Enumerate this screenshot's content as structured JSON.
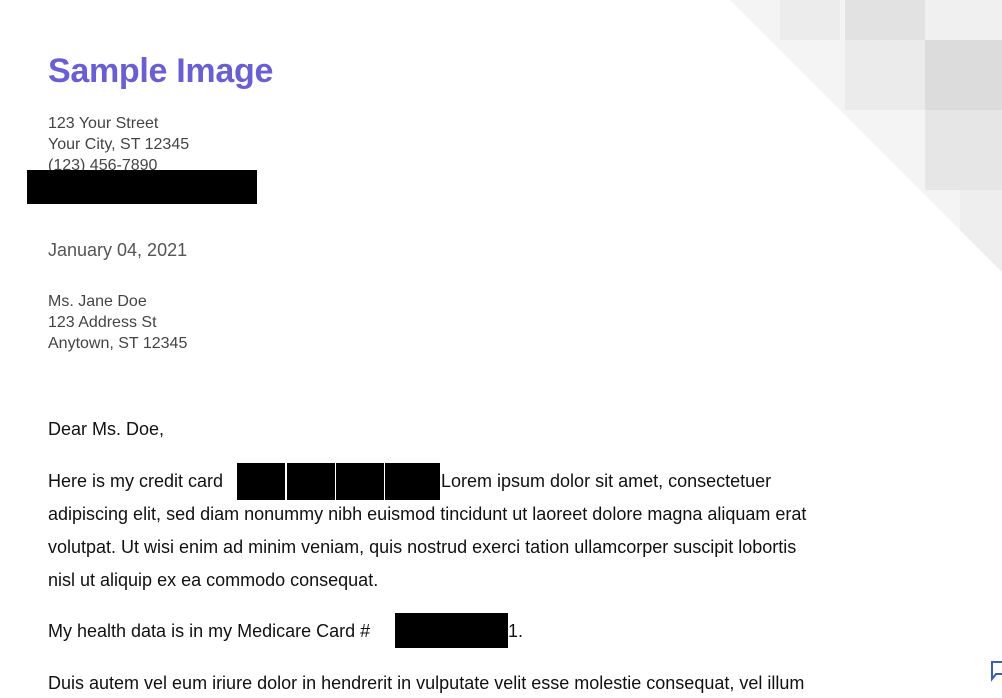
{
  "document": {
    "title": "Sample Image",
    "title_color": "#6a5fd1",
    "sender": {
      "street": "123 Your Street",
      "city": "Your City, ST 12345",
      "phone": "(123) 456-7890"
    },
    "date": "January 04, 2021",
    "recipient": {
      "name": "Ms. Jane Doe",
      "street": "123 Address St",
      "city": "Anytown, ST 12345"
    },
    "salutation": "Dear Ms. Doe,",
    "paragraph1": {
      "before_redaction": "Here is my credit card",
      "after_redaction": "Lorem ipsum dolor sit amet, consectetuer",
      "line2": "adipiscing elit, sed diam nonummy nibh euismod tincidunt ut laoreet dolore magna aliquam erat",
      "line3": "volutpat. Ut wisi enim ad minim veniam, quis nostrud exerci tation ullamcorper suscipit lobortis",
      "line4": "nisl ut aliquip ex ea commodo consequat."
    },
    "paragraph2": {
      "before_redaction": "My health data is in my Medicare Card #",
      "after_redaction": "1."
    },
    "paragraph3": {
      "line1": "Duis autem vel eum iriure dolor in hendrerit in vulputate velit esse molestie consequat, vel illum"
    }
  },
  "icons": {
    "feedback": "comment-icon"
  }
}
